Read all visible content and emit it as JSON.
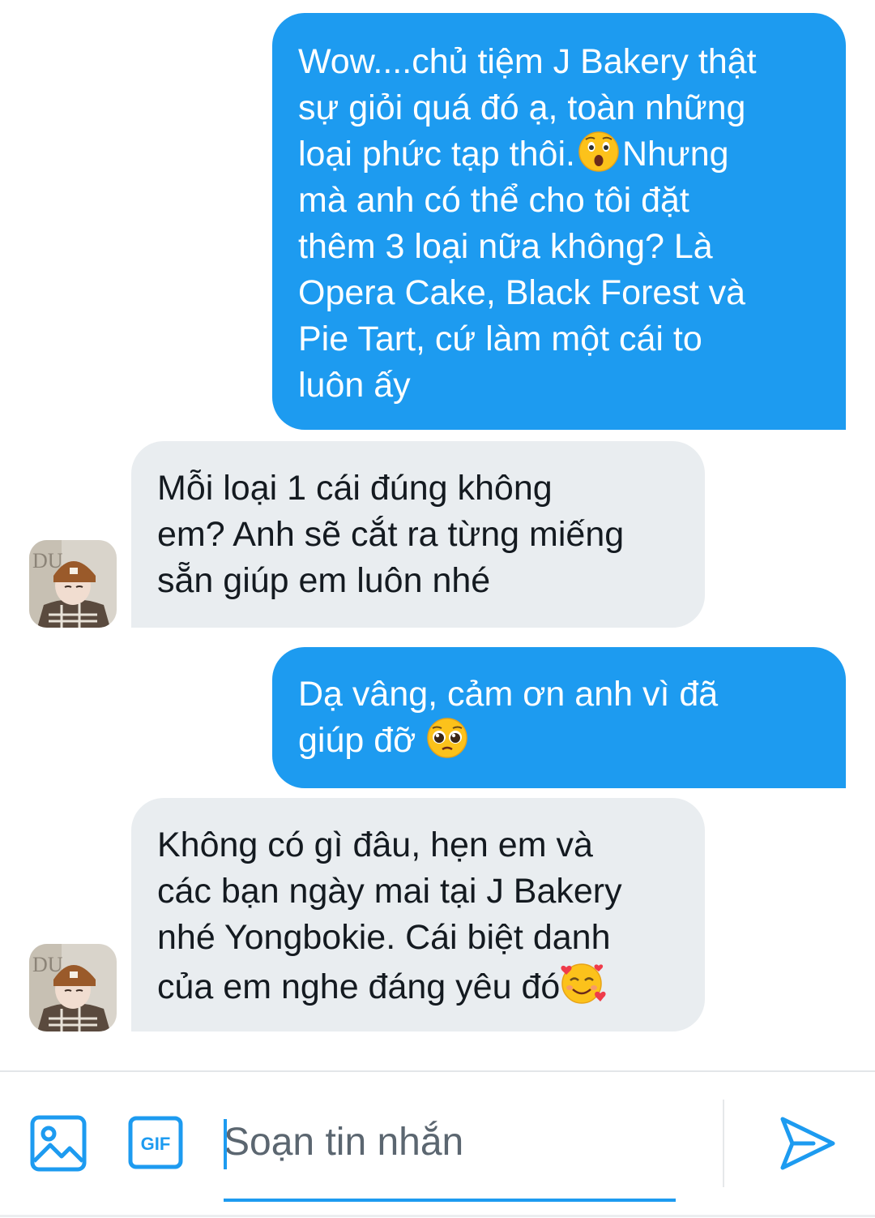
{
  "messages": [
    {
      "id": "msg-1",
      "side": "sent",
      "text_before": "Wow....chủ tiệm J Bakery thật\nsự giỏi quá đó ạ, toàn những\nloại phức tạp thôi.",
      "emoji": "astonished-face",
      "text_after": "Nhưng\nmà anh có thể cho tôi đặt\nthêm 3 loại nữa không? Là\nOpera Cake, Black Forest và\nPie Tart, cứ làm một cái to\nluôn ấy"
    },
    {
      "id": "msg-2",
      "side": "received",
      "text": "Mỗi loại 1 cái đúng không\nem? Anh sẽ cắt ra từng miếng\nsẵn giúp em luôn nhé"
    },
    {
      "id": "msg-3",
      "side": "sent",
      "text_before": "Dạ vâng, cảm ơn anh vì đã\ngiúp đỡ ",
      "emoji": "pleading-face"
    },
    {
      "id": "msg-4",
      "side": "received",
      "text_before": "Không có gì đâu, hẹn em và\ncác bạn ngày mai tại J Bakery\nnhé Yongbokie. Cái biệt danh\ncủa em nghe đáng yêu đó",
      "emoji": "smiling-face-with-hearts"
    }
  ],
  "composer": {
    "placeholder": "Soạn tin nhắn",
    "image_icon": "image-icon",
    "gif_label": "GIF",
    "send_icon": "send-icon"
  },
  "colors": {
    "accent": "#1d9bf0",
    "received_bubble": "#e9edf0",
    "text_dark": "#141a20",
    "placeholder": "#5b6670"
  }
}
